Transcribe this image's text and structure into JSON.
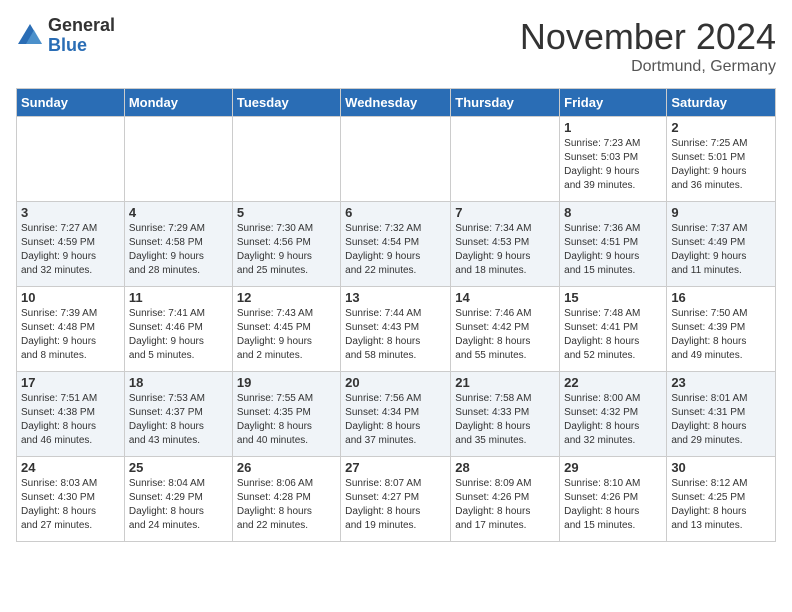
{
  "logo": {
    "general": "General",
    "blue": "Blue"
  },
  "header": {
    "month": "November 2024",
    "location": "Dortmund, Germany"
  },
  "weekdays": [
    "Sunday",
    "Monday",
    "Tuesday",
    "Wednesday",
    "Thursday",
    "Friday",
    "Saturday"
  ],
  "weeks": [
    [
      {
        "day": "",
        "info": ""
      },
      {
        "day": "",
        "info": ""
      },
      {
        "day": "",
        "info": ""
      },
      {
        "day": "",
        "info": ""
      },
      {
        "day": "",
        "info": ""
      },
      {
        "day": "1",
        "info": "Sunrise: 7:23 AM\nSunset: 5:03 PM\nDaylight: 9 hours\nand 39 minutes."
      },
      {
        "day": "2",
        "info": "Sunrise: 7:25 AM\nSunset: 5:01 PM\nDaylight: 9 hours\nand 36 minutes."
      }
    ],
    [
      {
        "day": "3",
        "info": "Sunrise: 7:27 AM\nSunset: 4:59 PM\nDaylight: 9 hours\nand 32 minutes."
      },
      {
        "day": "4",
        "info": "Sunrise: 7:29 AM\nSunset: 4:58 PM\nDaylight: 9 hours\nand 28 minutes."
      },
      {
        "day": "5",
        "info": "Sunrise: 7:30 AM\nSunset: 4:56 PM\nDaylight: 9 hours\nand 25 minutes."
      },
      {
        "day": "6",
        "info": "Sunrise: 7:32 AM\nSunset: 4:54 PM\nDaylight: 9 hours\nand 22 minutes."
      },
      {
        "day": "7",
        "info": "Sunrise: 7:34 AM\nSunset: 4:53 PM\nDaylight: 9 hours\nand 18 minutes."
      },
      {
        "day": "8",
        "info": "Sunrise: 7:36 AM\nSunset: 4:51 PM\nDaylight: 9 hours\nand 15 minutes."
      },
      {
        "day": "9",
        "info": "Sunrise: 7:37 AM\nSunset: 4:49 PM\nDaylight: 9 hours\nand 11 minutes."
      }
    ],
    [
      {
        "day": "10",
        "info": "Sunrise: 7:39 AM\nSunset: 4:48 PM\nDaylight: 9 hours\nand 8 minutes."
      },
      {
        "day": "11",
        "info": "Sunrise: 7:41 AM\nSunset: 4:46 PM\nDaylight: 9 hours\nand 5 minutes."
      },
      {
        "day": "12",
        "info": "Sunrise: 7:43 AM\nSunset: 4:45 PM\nDaylight: 9 hours\nand 2 minutes."
      },
      {
        "day": "13",
        "info": "Sunrise: 7:44 AM\nSunset: 4:43 PM\nDaylight: 8 hours\nand 58 minutes."
      },
      {
        "day": "14",
        "info": "Sunrise: 7:46 AM\nSunset: 4:42 PM\nDaylight: 8 hours\nand 55 minutes."
      },
      {
        "day": "15",
        "info": "Sunrise: 7:48 AM\nSunset: 4:41 PM\nDaylight: 8 hours\nand 52 minutes."
      },
      {
        "day": "16",
        "info": "Sunrise: 7:50 AM\nSunset: 4:39 PM\nDaylight: 8 hours\nand 49 minutes."
      }
    ],
    [
      {
        "day": "17",
        "info": "Sunrise: 7:51 AM\nSunset: 4:38 PM\nDaylight: 8 hours\nand 46 minutes."
      },
      {
        "day": "18",
        "info": "Sunrise: 7:53 AM\nSunset: 4:37 PM\nDaylight: 8 hours\nand 43 minutes."
      },
      {
        "day": "19",
        "info": "Sunrise: 7:55 AM\nSunset: 4:35 PM\nDaylight: 8 hours\nand 40 minutes."
      },
      {
        "day": "20",
        "info": "Sunrise: 7:56 AM\nSunset: 4:34 PM\nDaylight: 8 hours\nand 37 minutes."
      },
      {
        "day": "21",
        "info": "Sunrise: 7:58 AM\nSunset: 4:33 PM\nDaylight: 8 hours\nand 35 minutes."
      },
      {
        "day": "22",
        "info": "Sunrise: 8:00 AM\nSunset: 4:32 PM\nDaylight: 8 hours\nand 32 minutes."
      },
      {
        "day": "23",
        "info": "Sunrise: 8:01 AM\nSunset: 4:31 PM\nDaylight: 8 hours\nand 29 minutes."
      }
    ],
    [
      {
        "day": "24",
        "info": "Sunrise: 8:03 AM\nSunset: 4:30 PM\nDaylight: 8 hours\nand 27 minutes."
      },
      {
        "day": "25",
        "info": "Sunrise: 8:04 AM\nSunset: 4:29 PM\nDaylight: 8 hours\nand 24 minutes."
      },
      {
        "day": "26",
        "info": "Sunrise: 8:06 AM\nSunset: 4:28 PM\nDaylight: 8 hours\nand 22 minutes."
      },
      {
        "day": "27",
        "info": "Sunrise: 8:07 AM\nSunset: 4:27 PM\nDaylight: 8 hours\nand 19 minutes."
      },
      {
        "day": "28",
        "info": "Sunrise: 8:09 AM\nSunset: 4:26 PM\nDaylight: 8 hours\nand 17 minutes."
      },
      {
        "day": "29",
        "info": "Sunrise: 8:10 AM\nSunset: 4:26 PM\nDaylight: 8 hours\nand 15 minutes."
      },
      {
        "day": "30",
        "info": "Sunrise: 8:12 AM\nSunset: 4:25 PM\nDaylight: 8 hours\nand 13 minutes."
      }
    ]
  ]
}
